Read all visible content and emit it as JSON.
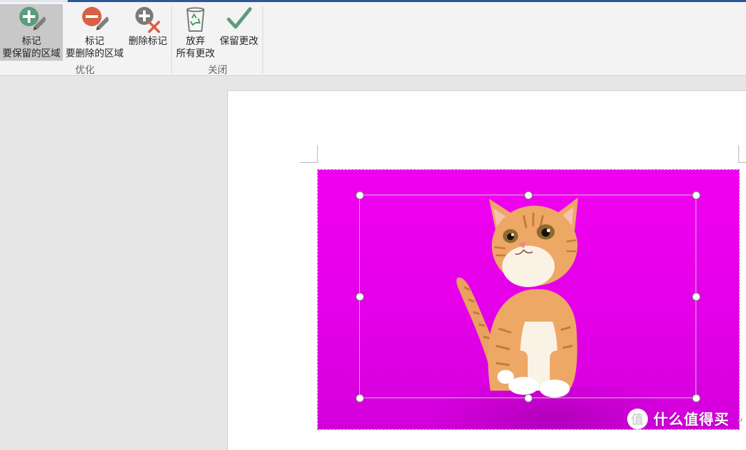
{
  "ribbon": {
    "groups": [
      {
        "label": "优化",
        "buttons": [
          {
            "line1": "标记",
            "line2": "要保留的区域",
            "icon": "mark-keep-icon",
            "active": true
          },
          {
            "line1": "标记",
            "line2": "要删除的区域",
            "icon": "mark-remove-icon",
            "active": false
          },
          {
            "line1": "删除标记",
            "line2": "",
            "icon": "delete-mark-icon",
            "active": false
          }
        ]
      },
      {
        "label": "关闭",
        "buttons": [
          {
            "line1": "放弃",
            "line2": "所有更改",
            "icon": "recycle-bin-icon",
            "active": false
          },
          {
            "line1": "保留更改",
            "line2": "",
            "icon": "checkmark-icon",
            "active": false
          }
        ]
      }
    ]
  },
  "watermark": {
    "text": "什么值得买",
    "logo_char": "值"
  },
  "colors": {
    "accent": "#2b579a",
    "background_fill": "#f000f0",
    "keep": "#5b9c7c",
    "remove": "#d95f45"
  }
}
